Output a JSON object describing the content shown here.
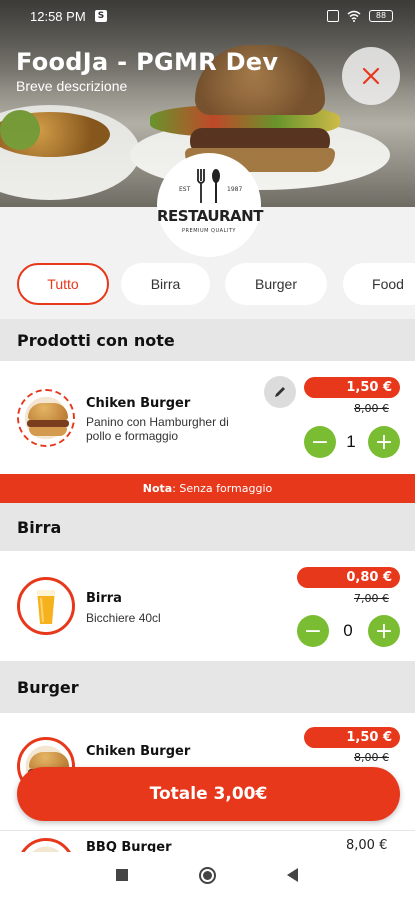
{
  "status_bar": {
    "time": "12:58 PM",
    "icon_s": "S",
    "battery": "88"
  },
  "header": {
    "title": "FoodJa - PGMR Dev",
    "description": "Breve descrizione",
    "close_icon": "close-icon"
  },
  "logo": {
    "est": "EST",
    "year": "1987",
    "word": "RESTAURANT",
    "sub": "PREMIUM QUALITY"
  },
  "categories": [
    {
      "label": "Tutto",
      "active": true
    },
    {
      "label": "Birra",
      "active": false
    },
    {
      "label": "Burger",
      "active": false
    },
    {
      "label": "Food",
      "active": false
    }
  ],
  "sections": {
    "notes": {
      "title": "Prodotti con note",
      "product": {
        "name": "Chiken Burger",
        "desc": "Panino con Hamburgher di pollo e formaggio",
        "price": "1,50 €",
        "old_price": "8,00 €",
        "qty": "1"
      },
      "note_label": "Nota",
      "note_text": ": Senza formaggio"
    },
    "birra": {
      "title": "Birra",
      "product": {
        "name": "Birra",
        "desc": "Bicchiere 40cl",
        "price": "0,80 €",
        "old_price": "7,00 €",
        "qty": "0"
      }
    },
    "burger": {
      "title": "Burger",
      "product1": {
        "name": "Chiken Burger",
        "price": "1,50 €",
        "old_price": "8,00 €"
      },
      "product2": {
        "name": "BBQ Burger",
        "price": "8,00 €"
      }
    }
  },
  "total": {
    "label": "Totale 3,00€"
  },
  "colors": {
    "accent": "#e8381c",
    "green": "#7bbd32",
    "section_bg": "#e6e6e6"
  }
}
